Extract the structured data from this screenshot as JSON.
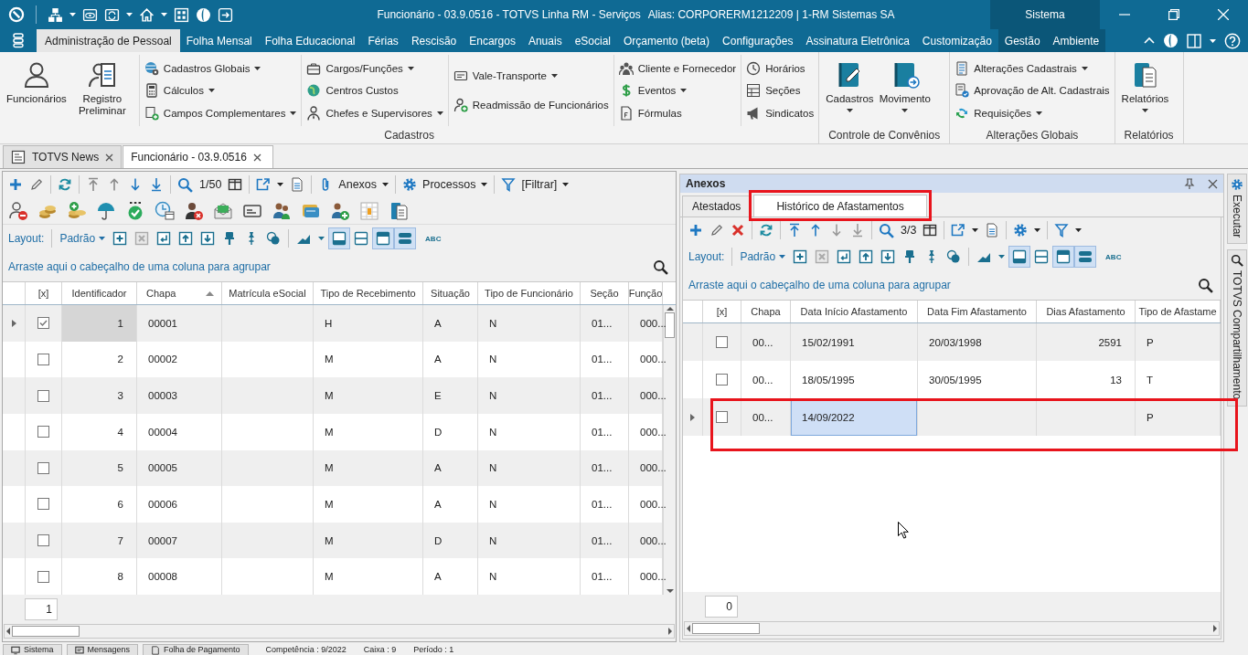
{
  "title_bar": {
    "title": "Funcionário - 03.9.0516 - TOTVS Linha RM - Serviços",
    "alias": "Alias: CORPORERM1212209 | 1-RM Sistemas SA",
    "section": "Sistema"
  },
  "menu_tabs": [
    {
      "label": "Administração de Pessoal",
      "selected": true,
      "kind": "module"
    },
    {
      "label": "Folha Mensal",
      "selected": false,
      "kind": "module"
    },
    {
      "label": "Folha Educacional",
      "selected": false,
      "kind": "module"
    },
    {
      "label": "Férias",
      "selected": false,
      "kind": "module"
    },
    {
      "label": "Rescisão",
      "selected": false,
      "kind": "module"
    },
    {
      "label": "Encargos",
      "selected": false,
      "kind": "module"
    },
    {
      "label": "Anuais",
      "selected": false,
      "kind": "module"
    },
    {
      "label": "eSocial",
      "selected": false,
      "kind": "module"
    },
    {
      "label": "Orçamento (beta)",
      "selected": false,
      "kind": "module"
    },
    {
      "label": "Configurações",
      "selected": false,
      "kind": "module"
    },
    {
      "label": "Assinatura Eletrônica",
      "selected": false,
      "kind": "module"
    },
    {
      "label": "Customização",
      "selected": false,
      "kind": "module"
    },
    {
      "label": "Gestão",
      "selected": false,
      "kind": "system"
    },
    {
      "label": "Ambiente",
      "selected": false,
      "kind": "system"
    }
  ],
  "ribbon": {
    "groups": [
      {
        "label": "Cadastros",
        "columns": [
          {
            "kind": "large",
            "items": [
              {
                "label": "Funcionários",
                "dropdown": false
              },
              {
                "label": "Registro Preliminar",
                "dropdown": false
              }
            ]
          },
          {
            "kind": "small",
            "items": [
              {
                "label": "Cadastros Globais",
                "dropdown": true
              },
              {
                "label": "Cálculos",
                "dropdown": true
              },
              {
                "label": "Campos Complementares",
                "dropdown": true
              }
            ]
          },
          {
            "kind": "small",
            "items": [
              {
                "label": "Cargos/Funções",
                "dropdown": true
              },
              {
                "label": "Centros Custos",
                "dropdown": false
              },
              {
                "label": "Chefes e Supervisores",
                "dropdown": true
              }
            ]
          },
          {
            "kind": "small",
            "items": [
              {
                "label": "Vale-Transporte",
                "dropdown": true
              },
              {
                "label": "Readmissão de Funcionários",
                "dropdown": false
              }
            ]
          },
          {
            "kind": "small",
            "items": [
              {
                "label": "Cliente e Fornecedor",
                "dropdown": false
              },
              {
                "label": "Eventos",
                "dropdown": true
              },
              {
                "label": "Fórmulas",
                "dropdown": false
              }
            ]
          },
          {
            "kind": "small",
            "items": [
              {
                "label": "Horários",
                "dropdown": false
              },
              {
                "label": "Seções",
                "dropdown": false
              },
              {
                "label": "Sindicatos",
                "dropdown": false
              }
            ]
          }
        ]
      },
      {
        "label": "Controle de Convênios",
        "columns": [
          {
            "kind": "large",
            "items": [
              {
                "label": "Cadastros",
                "dropdown": true
              },
              {
                "label": "Movimento",
                "dropdown": true
              }
            ]
          }
        ]
      },
      {
        "label": "Alterações Globais",
        "columns": [
          {
            "kind": "small",
            "items": [
              {
                "label": "Alterações Cadastrais",
                "dropdown": true
              },
              {
                "label": "Aprovação de Alt. Cadastrais",
                "dropdown": false
              },
              {
                "label": "Requisições",
                "dropdown": true
              }
            ]
          }
        ]
      },
      {
        "label": "Relatórios",
        "columns": [
          {
            "kind": "large",
            "items": [
              {
                "label": "Relatórios",
                "dropdown": true
              }
            ]
          }
        ]
      }
    ]
  },
  "document_tabs": [
    {
      "label": "TOTVS News",
      "selected": false
    },
    {
      "label": "Funcionário - 03.9.0516",
      "selected": true
    }
  ],
  "employees": {
    "toolbar": {
      "counter": "1/50",
      "menus": [
        {
          "label": "Anexos"
        },
        {
          "label": "Processos"
        },
        {
          "label": "[Filtrar]"
        }
      ]
    },
    "layout_bar": {
      "label": "Layout:",
      "preset": "Padrão",
      "toggles": [
        {
          "on": true
        },
        {
          "on": false
        },
        {
          "on": true
        },
        {
          "on": true
        }
      ],
      "text_tool": "ABC"
    },
    "group_hint": "Arraste aqui o cabeçalho de uma coluna para agrupar",
    "columns": [
      {
        "label": "[x]",
        "sorted": false
      },
      {
        "label": "Identificador",
        "sorted": false
      },
      {
        "label": "Chapa",
        "sorted": true
      },
      {
        "label": "Matrícula eSocial",
        "sorted": false
      },
      {
        "label": "Tipo de Recebimento",
        "sorted": false
      },
      {
        "label": "Situação",
        "sorted": false
      },
      {
        "label": "Tipo de Funcionário",
        "sorted": false
      },
      {
        "label": "Seção",
        "sorted": false
      },
      {
        "label": "Função",
        "sorted": false
      }
    ],
    "rows": [
      {
        "selected": true,
        "cells": [
          {
            "kind": "checkbox",
            "checked": true
          },
          {
            "kind": "text",
            "text": "1",
            "focused": true
          },
          {
            "kind": "text",
            "text": "00001",
            "focused": false
          },
          {
            "kind": "empty"
          },
          {
            "kind": "text",
            "text": "H",
            "focused": false
          },
          {
            "kind": "text",
            "text": "A",
            "focused": false
          },
          {
            "kind": "text",
            "text": "N",
            "focused": false
          },
          {
            "kind": "text",
            "text": "01...",
            "focused": false
          },
          {
            "kind": "text",
            "text": "000...",
            "focused": false
          }
        ]
      },
      {
        "selected": false,
        "cells": [
          {
            "kind": "checkbox",
            "checked": false
          },
          {
            "kind": "text",
            "text": "2",
            "focused": false
          },
          {
            "kind": "text",
            "text": "00002",
            "focused": false
          },
          {
            "kind": "empty"
          },
          {
            "kind": "text",
            "text": "M",
            "focused": false
          },
          {
            "kind": "text",
            "text": "A",
            "focused": false
          },
          {
            "kind": "text",
            "text": "N",
            "focused": false
          },
          {
            "kind": "text",
            "text": "01...",
            "focused": false
          },
          {
            "kind": "text",
            "text": "000...",
            "focused": false
          }
        ]
      },
      {
        "selected": false,
        "cells": [
          {
            "kind": "checkbox",
            "checked": false
          },
          {
            "kind": "text",
            "text": "3",
            "focused": false
          },
          {
            "kind": "text",
            "text": "00003",
            "focused": false
          },
          {
            "kind": "empty"
          },
          {
            "kind": "text",
            "text": "M",
            "focused": false
          },
          {
            "kind": "text",
            "text": "E",
            "focused": false
          },
          {
            "kind": "text",
            "text": "N",
            "focused": false
          },
          {
            "kind": "text",
            "text": "01...",
            "focused": false
          },
          {
            "kind": "text",
            "text": "000...",
            "focused": false
          }
        ]
      },
      {
        "selected": false,
        "cells": [
          {
            "kind": "checkbox",
            "checked": false
          },
          {
            "kind": "text",
            "text": "4",
            "focused": false
          },
          {
            "kind": "text",
            "text": "00004",
            "focused": false
          },
          {
            "kind": "empty"
          },
          {
            "kind": "text",
            "text": "M",
            "focused": false
          },
          {
            "kind": "text",
            "text": "D",
            "focused": false
          },
          {
            "kind": "text",
            "text": "N",
            "focused": false
          },
          {
            "kind": "text",
            "text": "01...",
            "focused": false
          },
          {
            "kind": "text",
            "text": "000...",
            "focused": false
          }
        ]
      },
      {
        "selected": false,
        "cells": [
          {
            "kind": "checkbox",
            "checked": false
          },
          {
            "kind": "text",
            "text": "5",
            "focused": false
          },
          {
            "kind": "text",
            "text": "00005",
            "focused": false
          },
          {
            "kind": "empty"
          },
          {
            "kind": "text",
            "text": "M",
            "focused": false
          },
          {
            "kind": "text",
            "text": "A",
            "focused": false
          },
          {
            "kind": "text",
            "text": "N",
            "focused": false
          },
          {
            "kind": "text",
            "text": "01...",
            "focused": false
          },
          {
            "kind": "text",
            "text": "000...",
            "focused": false
          }
        ]
      },
      {
        "selected": false,
        "cells": [
          {
            "kind": "checkbox",
            "checked": false
          },
          {
            "kind": "text",
            "text": "6",
            "focused": false
          },
          {
            "kind": "text",
            "text": "00006",
            "focused": false
          },
          {
            "kind": "empty"
          },
          {
            "kind": "text",
            "text": "M",
            "focused": false
          },
          {
            "kind": "text",
            "text": "A",
            "focused": false
          },
          {
            "kind": "text",
            "text": "N",
            "focused": false
          },
          {
            "kind": "text",
            "text": "01...",
            "focused": false
          },
          {
            "kind": "text",
            "text": "000...",
            "focused": false
          }
        ]
      },
      {
        "selected": false,
        "cells": [
          {
            "kind": "checkbox",
            "checked": false
          },
          {
            "kind": "text",
            "text": "7",
            "focused": false
          },
          {
            "kind": "text",
            "text": "00007",
            "focused": false
          },
          {
            "kind": "empty"
          },
          {
            "kind": "text",
            "text": "M",
            "focused": false
          },
          {
            "kind": "text",
            "text": "D",
            "focused": false
          },
          {
            "kind": "text",
            "text": "N",
            "focused": false
          },
          {
            "kind": "text",
            "text": "01...",
            "focused": false
          },
          {
            "kind": "text",
            "text": "000...",
            "focused": false
          }
        ]
      },
      {
        "selected": false,
        "cells": [
          {
            "kind": "checkbox",
            "checked": false
          },
          {
            "kind": "text",
            "text": "8",
            "focused": false
          },
          {
            "kind": "text",
            "text": "00008",
            "focused": false
          },
          {
            "kind": "empty"
          },
          {
            "kind": "text",
            "text": "M",
            "focused": false
          },
          {
            "kind": "text",
            "text": "A",
            "focused": false
          },
          {
            "kind": "text",
            "text": "N",
            "focused": false
          },
          {
            "kind": "text",
            "text": "01...",
            "focused": false
          },
          {
            "kind": "text",
            "text": "000...",
            "focused": false
          }
        ]
      }
    ],
    "record_count": "1"
  },
  "attachments": {
    "title": "Anexos",
    "tabs": [
      {
        "label": "Atestados",
        "selected": false,
        "highlighted": false
      },
      {
        "label": "Histórico de Afastamentos",
        "selected": true,
        "highlighted": true
      }
    ],
    "toolbar": {
      "counter": "3/3"
    },
    "layout_bar": {
      "label": "Layout:",
      "preset": "Padrão",
      "toggles": [
        {
          "on": true
        },
        {
          "on": false
        },
        {
          "on": true
        },
        {
          "on": true
        }
      ],
      "text_tool": "ABC"
    },
    "group_hint": "Arraste aqui o cabeçalho de uma coluna para agrupar",
    "columns": [
      {
        "label": "[x]",
        "sorted": false
      },
      {
        "label": "Chapa",
        "sorted": false
      },
      {
        "label": "Data Início Afastamento",
        "sorted": false
      },
      {
        "label": "Data Fim Afastamento",
        "sorted": false
      },
      {
        "label": "Dias Afastamento",
        "sorted": false
      },
      {
        "label": "Tipo de Afastame",
        "sorted": false
      }
    ],
    "rows": [
      {
        "selected": false,
        "highlighted": false,
        "cells": [
          {
            "kind": "checkbox",
            "checked": false
          },
          {
            "kind": "text",
            "text": "00...",
            "focused": false
          },
          {
            "kind": "text",
            "text": "15/02/1991",
            "focused": false
          },
          {
            "kind": "text",
            "text": "20/03/1998",
            "focused": false
          },
          {
            "kind": "text",
            "text": "2591",
            "focused": false
          },
          {
            "kind": "text",
            "text": "P",
            "focused": false
          }
        ]
      },
      {
        "selected": false,
        "highlighted": false,
        "cells": [
          {
            "kind": "checkbox",
            "checked": false
          },
          {
            "kind": "text",
            "text": "00...",
            "focused": false
          },
          {
            "kind": "text",
            "text": "18/05/1995",
            "focused": false
          },
          {
            "kind": "text",
            "text": "30/05/1995",
            "focused": false
          },
          {
            "kind": "text",
            "text": "13",
            "focused": false
          },
          {
            "kind": "text",
            "text": "T",
            "focused": false
          }
        ]
      },
      {
        "selected": true,
        "highlighted": true,
        "cells": [
          {
            "kind": "checkbox",
            "checked": false
          },
          {
            "kind": "text",
            "text": "00...",
            "focused": false
          },
          {
            "kind": "text",
            "text": "14/09/2022",
            "focused": true
          },
          {
            "kind": "empty"
          },
          {
            "kind": "empty"
          },
          {
            "kind": "text",
            "text": "P",
            "focused": false
          }
        ]
      }
    ],
    "record_count": "0"
  },
  "side_panels": [
    {
      "label": "Executar"
    },
    {
      "label": "TOTVS Compartilhamento"
    }
  ],
  "status_bar": {
    "tabs": [
      {
        "label": "Sistema"
      },
      {
        "label": "Mensagens"
      },
      {
        "label": "Folha de Pagamento"
      }
    ],
    "fields": [
      "Competência : 9/2022",
      "Caixa : 9",
      "Período : 1"
    ]
  }
}
